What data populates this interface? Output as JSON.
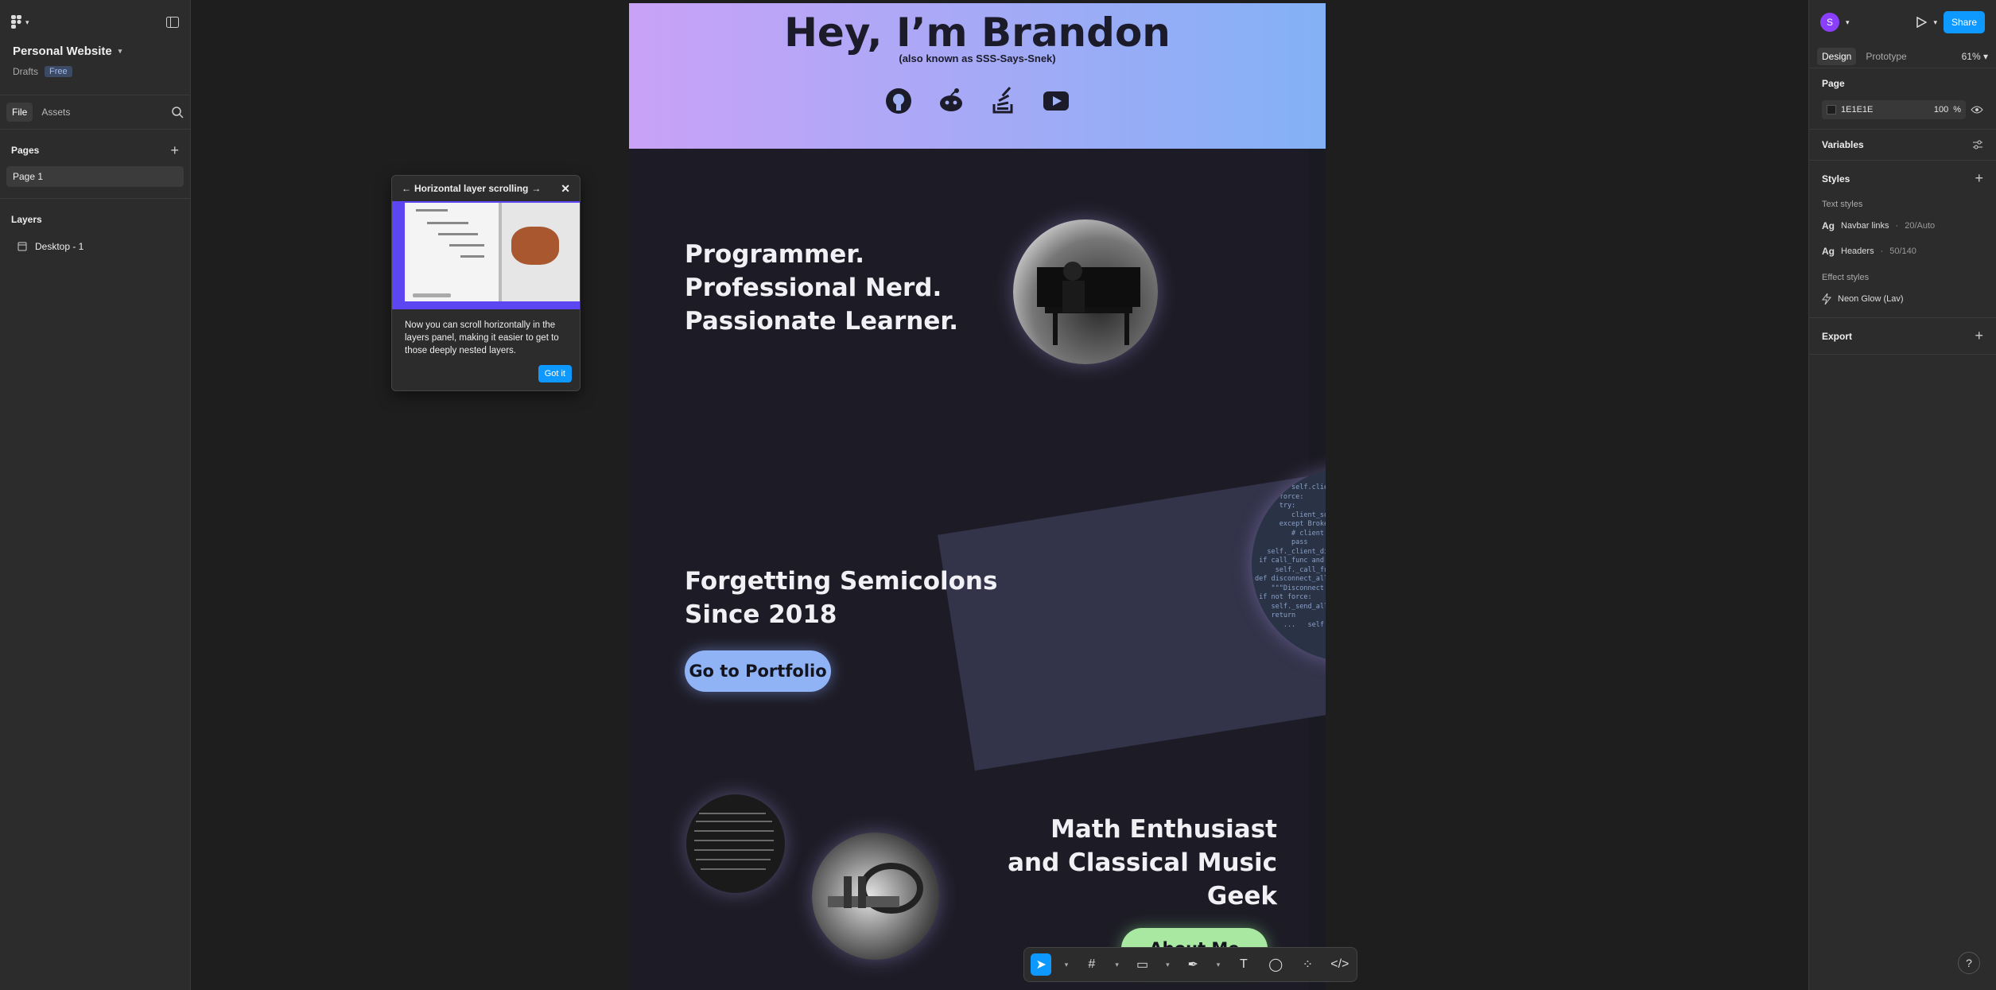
{
  "left_panel": {
    "project_name": "Personal Website",
    "location": "Drafts",
    "plan_badge": "Free",
    "tabs": [
      "File",
      "Assets"
    ],
    "pages_header": "Pages",
    "pages": [
      "Page 1"
    ],
    "layers_header": "Layers",
    "layers": [
      "Desktop - 1"
    ]
  },
  "tooltip": {
    "title": "Horizontal layer scrolling",
    "body": "Now you can scroll horizontally in the layers panel, making it easier to get to those deeply nested layers.",
    "button": "Got it"
  },
  "design_frame": {
    "hero_title": "Hey, I’m Brandon",
    "hero_subtitle": "(also known as SSS-Says-Snek)",
    "social_icons": [
      "github-icon",
      "reddit-icon",
      "stackoverflow-icon",
      "youtube-icon"
    ],
    "headline_1": [
      "Programmer.",
      "Professional Nerd.",
      "Passionate Learner."
    ],
    "headline_2": [
      "Forgetting Semicolons",
      "Since 2018"
    ],
    "portfolio_button": "Go to Portfolio",
    "headline_3": [
      "Math Enthusiast",
      "and Classical Music",
      "Geek"
    ],
    "about_button": "About Me"
  },
  "right_panel": {
    "avatar_letter": "S",
    "share": "Share",
    "tabs": [
      "Design",
      "Prototype"
    ],
    "zoom": "61%",
    "page_section": "Page",
    "page_fill": "1E1E1E",
    "page_opacity": "100",
    "percent": "%",
    "variables": "Variables",
    "styles": "Styles",
    "text_styles_label": "Text styles",
    "text_styles": [
      {
        "name": "Navbar links",
        "meta": "20/Auto"
      },
      {
        "name": "Headers",
        "meta": "50/140"
      }
    ],
    "effect_styles_label": "Effect styles",
    "effect_styles": [
      "Neon Glow (Lav)"
    ],
    "export": "Export"
  },
  "colors": {
    "accent": "#0d99ff",
    "hero_gradient_start": "#c9a2f7",
    "hero_gradient_end": "#83b1f6",
    "portfolio_button": "#8fb3f5",
    "about_button": "#a8e8a0"
  }
}
